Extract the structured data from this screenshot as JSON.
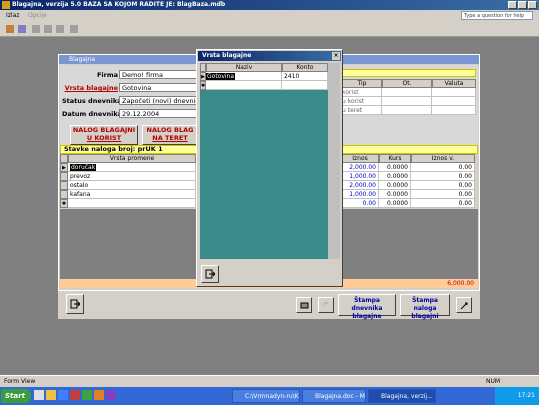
{
  "app": {
    "title": "Blagajna, verzija 5.0      BAZA SA KOJOM RADITE JE: BlagBaza.mdb"
  },
  "menu": {
    "items": [
      "Izlaz",
      "Opcije"
    ],
    "help_placeholder": "Type a question for help"
  },
  "form": {
    "title": "Blagajna",
    "labels": {
      "firma": "Firma",
      "vrsta_blagajne": "Vrsta blagajne",
      "status_dnevnika": "Status dnevnika",
      "datum_dnevnika": "Datum dnevnika"
    },
    "values": {
      "firma": "Demo! firma",
      "vrsta_blagajne": "Gotovina",
      "status_dnevnika": "Započeti (novi) dnevnici",
      "datum_dnevnika": "29.12.2004"
    },
    "buttons": {
      "nalog_korist_1": "NALOG BLAGAJNI",
      "nalog_korist_2": "U KORIST",
      "nalog_teret_1": "NALOG BLAG",
      "nalog_teret_2": "NA TERET"
    },
    "right_table": {
      "headers": [
        "Tip",
        "Ot.",
        "Valuta"
      ],
      "rows": [
        "korist",
        "u korist",
        "u teret"
      ]
    },
    "stavke_title": "Stavke naloga broj: prUK 1",
    "stavke_headers": [
      "Vrsta promene",
      "Iznos",
      "Kurs",
      "Iznos v."
    ],
    "stavke_rows": [
      {
        "vrsta": "doručak",
        "iznos": "2,000.00",
        "kurs": "0.0000",
        "iznos_v": "0.00"
      },
      {
        "vrsta": "prevoz",
        "iznos": "1,000.00",
        "kurs": "0.0000",
        "iznos_v": "0.00"
      },
      {
        "vrsta": "ostalo",
        "iznos": "2,000.00",
        "kurs": "0.0000",
        "iznos_v": "0.00"
      },
      {
        "vrsta": "kafana",
        "iznos": "1,000.00",
        "kurs": "0.0000",
        "iznos_v": "0.00"
      },
      {
        "vrsta": "",
        "iznos": "0.00",
        "kurs": "0.0000",
        "iznos_v": "0.00"
      }
    ],
    "total": "6,000.00",
    "bottom_buttons": {
      "stampa_dnevnika": "Štampa dnevnika blagajne",
      "stampa_naloga": "Štampa naloga blagajni"
    }
  },
  "popup": {
    "title": "Vrsta blagajne",
    "headers": [
      "Naziv",
      "Konto"
    ],
    "rows": [
      {
        "naziv": "Gotovina",
        "konto": "2410"
      }
    ]
  },
  "statusbar": {
    "left": "Form View",
    "right": "NUM"
  },
  "taskbar": {
    "start": "Start",
    "tasks": [
      "C:\\Vrmnadyn-ru\\Kd...",
      "Blagajna.doc - Mic...",
      "Blagajna, verzij..."
    ],
    "clock": "17:21"
  },
  "colors": {
    "title_blue": "#0a246a",
    "yellow_bar": "#ffff99",
    "orange_total_bar": "#ffcc99",
    "teal_popup": "#3a8a8a",
    "red_label": "#b00000"
  }
}
